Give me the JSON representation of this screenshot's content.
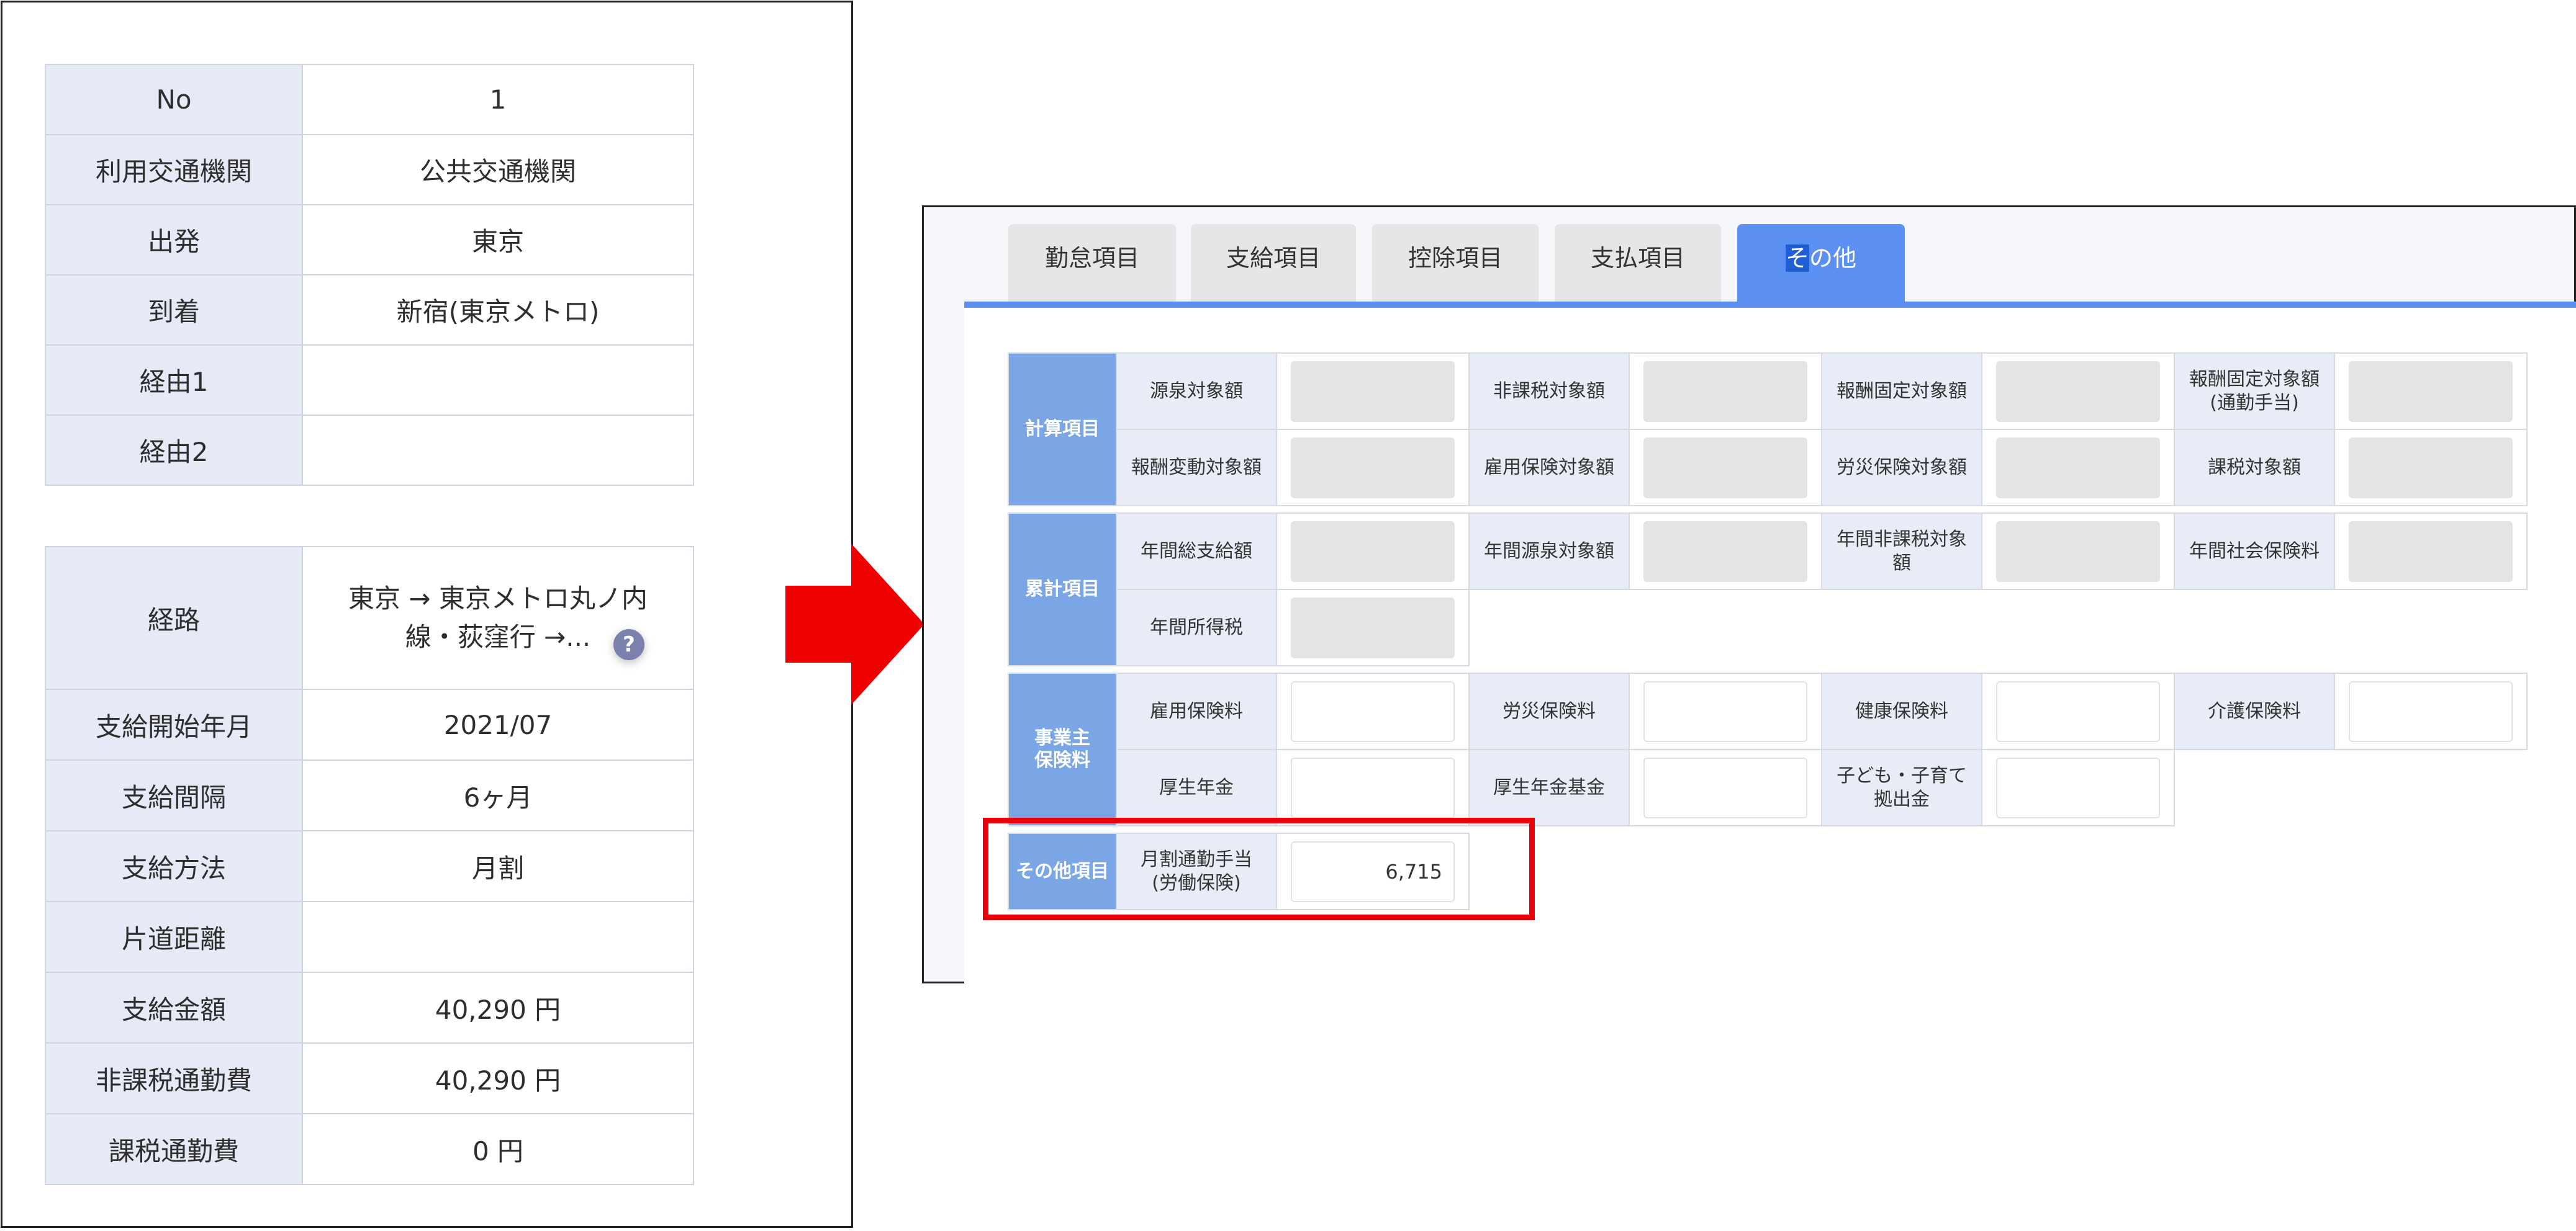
{
  "left_table_1": [
    {
      "label": "No",
      "value": "1"
    },
    {
      "label": "利用交通機関",
      "value": "公共交通機関"
    },
    {
      "label": "出発",
      "value": "東京"
    },
    {
      "label": "到着",
      "value": "新宿(東京メトロ)"
    },
    {
      "label": "経由1",
      "value": ""
    },
    {
      "label": "経由2",
      "value": ""
    }
  ],
  "left_table_2": {
    "route": {
      "label": "経路",
      "line1": "東京 → 東京メトロ丸ノ内",
      "line2": "線・荻窪行 →...",
      "help_icon": "?"
    },
    "rows": [
      {
        "label": "支給開始年月",
        "value": "2021/07"
      },
      {
        "label": "支給間隔",
        "value": "6ヶ月"
      },
      {
        "label": "支給方法",
        "value": "月割"
      },
      {
        "label": "片道距離",
        "value": ""
      },
      {
        "label": "支給金額",
        "value": "40,290 円"
      },
      {
        "label": "非課税通勤費",
        "value": "40,290 円"
      },
      {
        "label": "課税通勤費",
        "value": "0 円"
      }
    ]
  },
  "arrow_color": "#ee0000",
  "tabs": [
    {
      "label": "勤怠項目"
    },
    {
      "label": "支給項目"
    },
    {
      "label": "控除項目"
    },
    {
      "label": "支払項目"
    },
    {
      "label_hl": "そ",
      "label_rest": "の他"
    }
  ],
  "accent_color": "#5b8ff2",
  "sections": {
    "calc": {
      "title": "計算項目",
      "r1": [
        "源泉対象額",
        "非課税対象額",
        "報酬固定対象額",
        "報酬固定対象額"
      ],
      "r1_sub": "(通勤手当)",
      "r2": [
        "報酬変動対象額",
        "雇用保険対象額",
        "労災保険対象額",
        "課税対象額"
      ]
    },
    "cumulative": {
      "title": "累計項目",
      "r1": [
        "年間総支給額",
        "年間源泉対象額",
        "年間非課税対象",
        "年間社会保険料"
      ],
      "r1_sub": "額",
      "r2": [
        "年間所得税"
      ]
    },
    "employer": {
      "title_1": "事業主",
      "title_2": "保険料",
      "r1": [
        "雇用保険料",
        "労災保険料",
        "健康保険料",
        "介護保険料"
      ],
      "r2": [
        "厚生年金",
        "厚生年金基金",
        "子ども・子育て"
      ],
      "r2_sub": "拠出金"
    },
    "other": {
      "title": "その他項目",
      "label_1": "月割通勤手当",
      "label_2": "(労働保険)",
      "value": "6,715"
    }
  },
  "highlight_color": "#e8000b"
}
